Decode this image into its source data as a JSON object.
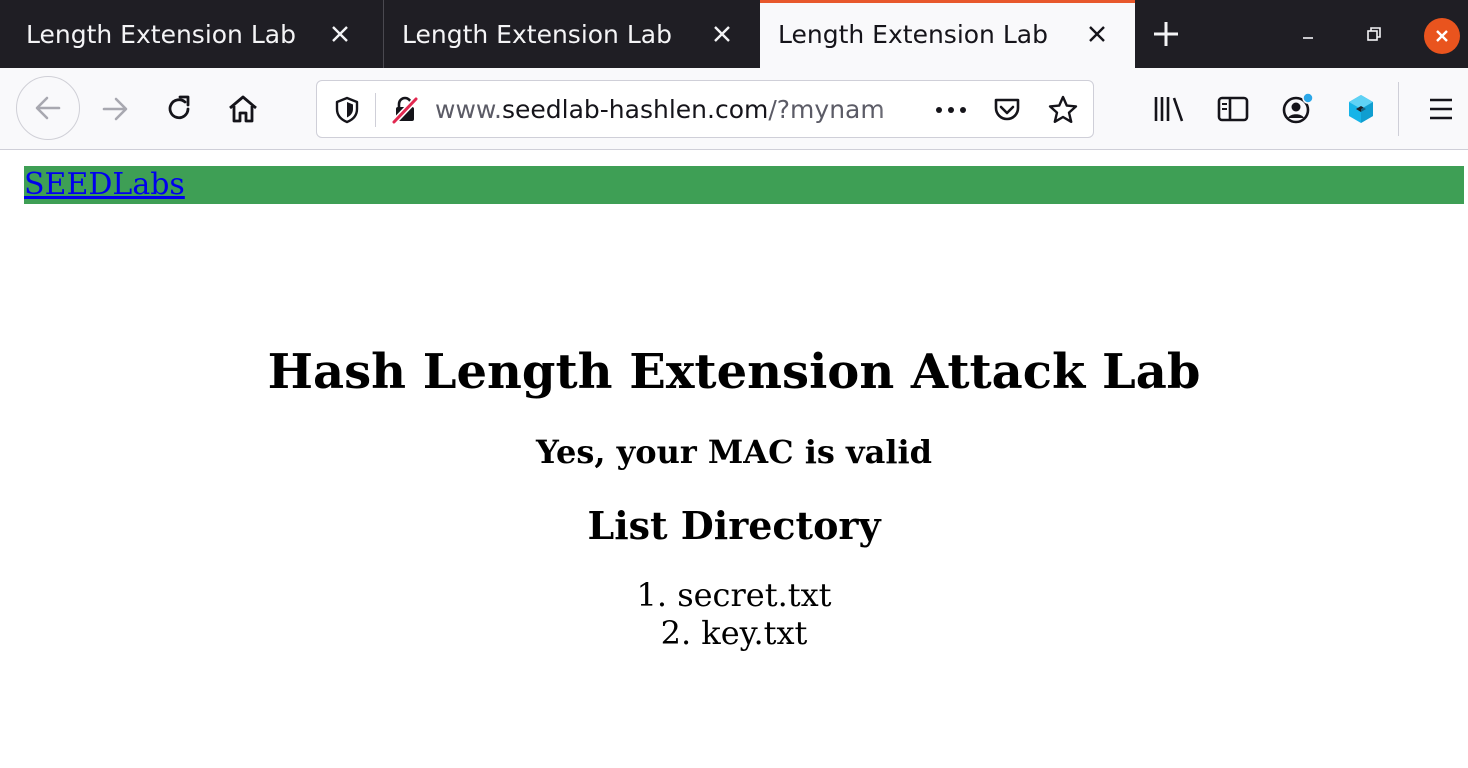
{
  "browser": {
    "tabs": [
      {
        "title": "Length Extension Lab",
        "active": false
      },
      {
        "title": "Length Extension Lab",
        "active": false
      },
      {
        "title": "Length Extension Lab",
        "active": true
      }
    ],
    "url": {
      "prefix": "www.",
      "host": "seedlab-hashlen.com",
      "path": "/?mynam"
    },
    "colors": {
      "accent": "#e8582c",
      "window_close": "#e9541e"
    }
  },
  "page": {
    "nav_link": "SEEDLabs",
    "nav_bar_color": "#3e9f55",
    "title": "Hash Length Extension Attack Lab",
    "status": "Yes, your MAC is valid",
    "section_title": "List Directory",
    "files": [
      {
        "index": "1.",
        "name": "secret.txt"
      },
      {
        "index": "2.",
        "name": "key.txt"
      }
    ]
  }
}
